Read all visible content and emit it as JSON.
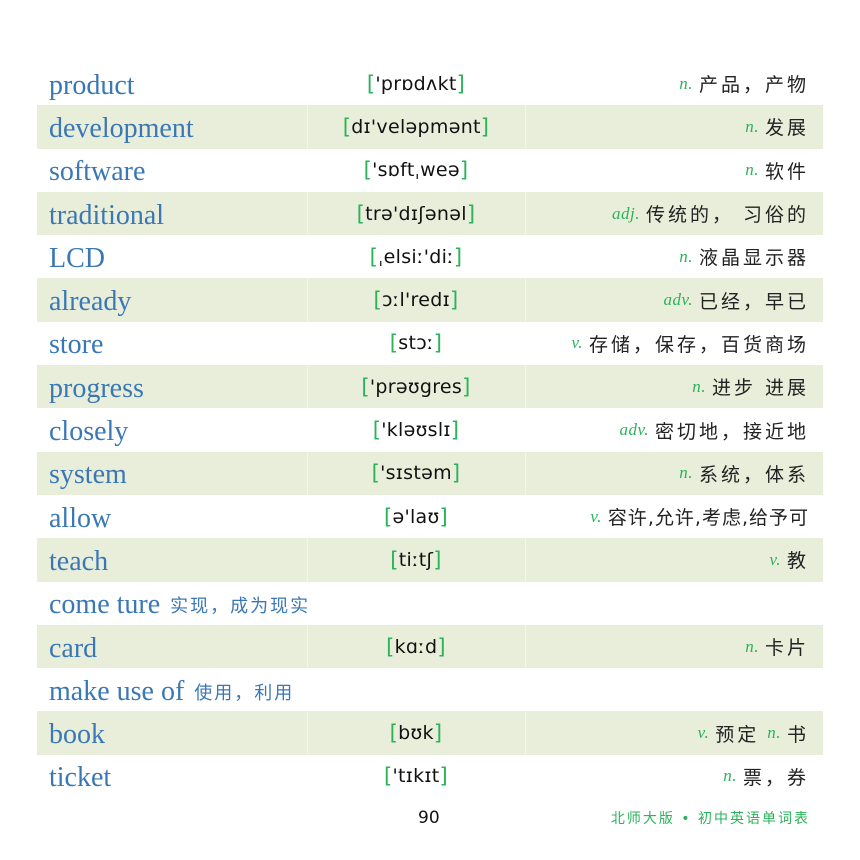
{
  "colors": {
    "word": "#3a78b5",
    "accent_green": "#2bb35a",
    "row_shade": "#e9eedb",
    "text": "#222222"
  },
  "entries": [
    {
      "word": "product",
      "phonetic": "'prɒdʌkt",
      "pos": "n.",
      "meaning": "产品，产物",
      "pos2": "",
      "meaning2": ""
    },
    {
      "word": "development",
      "phonetic": "dɪ'veləpmənt",
      "pos": "n.",
      "meaning": "发展",
      "pos2": "",
      "meaning2": ""
    },
    {
      "word": "software",
      "phonetic": "'sɒftˌweə",
      "pos": "n.",
      "meaning": "软件",
      "pos2": "",
      "meaning2": ""
    },
    {
      "word": "traditional",
      "phonetic": "trə'dɪʃənəl",
      "pos": "adj.",
      "meaning": "传统的， 习俗的",
      "pos2": "",
      "meaning2": ""
    },
    {
      "word": "LCD",
      "phonetic": "ˌelsiː'diː",
      "pos": "n.",
      "meaning": "液晶显示器",
      "pos2": "",
      "meaning2": ""
    },
    {
      "word": "already",
      "phonetic": "ɔːl'redɪ",
      "pos": "adv.",
      "meaning": "已经，早已",
      "pos2": "",
      "meaning2": ""
    },
    {
      "word": "store",
      "phonetic": "stɔː",
      "pos": "v.",
      "meaning": "存储，保存，百货商场",
      "pos2": "",
      "meaning2": ""
    },
    {
      "word": "progress",
      "phonetic": "'prəʊgres",
      "pos": "n.",
      "meaning": "进步 进展",
      "pos2": "",
      "meaning2": ""
    },
    {
      "word": "closely",
      "phonetic": "'kləʊslɪ",
      "pos": "adv.",
      "meaning": "密切地，接近地",
      "pos2": "",
      "meaning2": ""
    },
    {
      "word": "system",
      "phonetic": "'sɪstəm",
      "pos": "n.",
      "meaning": "系统，体系",
      "pos2": "",
      "meaning2": ""
    },
    {
      "word": "allow",
      "phonetic": "ə'laʊ",
      "pos": "v.",
      "meaning": "容许,允许,考虑,给予可",
      "pos2": "",
      "meaning2": ""
    },
    {
      "word": "teach",
      "phonetic": "tiːtʃ",
      "pos": "v.",
      "meaning": "教",
      "pos2": "",
      "meaning2": ""
    },
    {
      "phrase": "come ture",
      "phrase_meaning": "实现，成为现实"
    },
    {
      "word": "card",
      "phonetic": "kɑːd",
      "pos": "n.",
      "meaning": "卡片",
      "pos2": "",
      "meaning2": ""
    },
    {
      "phrase": "make use of",
      "phrase_meaning": "使用，利用"
    },
    {
      "word": "book",
      "phonetic": "bʊk",
      "pos": "v.",
      "meaning": "预定",
      "pos2": "n.",
      "meaning2": "书"
    },
    {
      "word": "ticket",
      "phonetic": "'tɪkɪt",
      "pos": "n.",
      "meaning": "票，券",
      "pos2": "",
      "meaning2": ""
    }
  ],
  "brackets": {
    "open": "[",
    "close": "]"
  },
  "footer": {
    "page_number": "90",
    "book_title": "北师大版 • 初中英语单词表"
  }
}
